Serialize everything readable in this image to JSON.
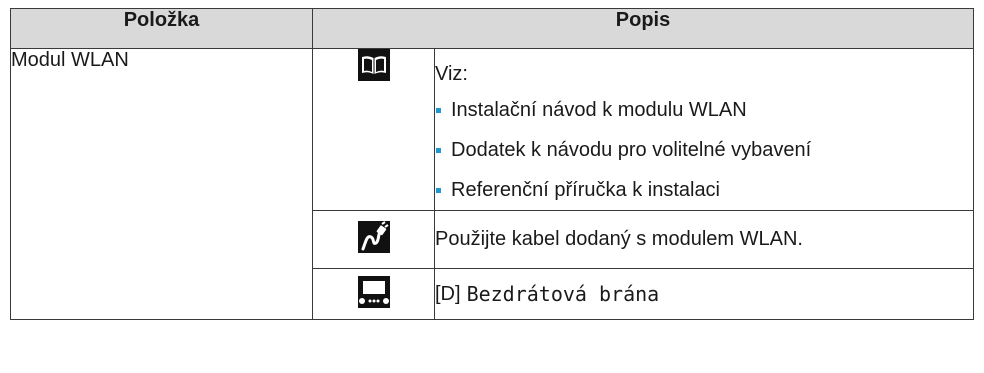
{
  "table": {
    "header": {
      "col_item": "Položka",
      "col_desc": "Popis"
    },
    "item_name": "Modul WLAN",
    "rows": [
      {
        "icon": "manual-book-icon",
        "intro": "Viz:",
        "bullets": [
          "Instalační návod k modulu WLAN",
          "Dodatek k návodu pro volitelné vybavení",
          "Referenční příručka k instalaci"
        ]
      },
      {
        "icon": "cable-plug-icon",
        "text": "Použijte kabel dodaný s modulem WLAN."
      },
      {
        "icon": "gateway-device-icon",
        "code": "[D]",
        "label": "Bezdrátová brána"
      }
    ]
  },
  "colors": {
    "header_bg": "#d9d9d9",
    "bullet": "#2196d3",
    "border": "#3a3a3a"
  }
}
